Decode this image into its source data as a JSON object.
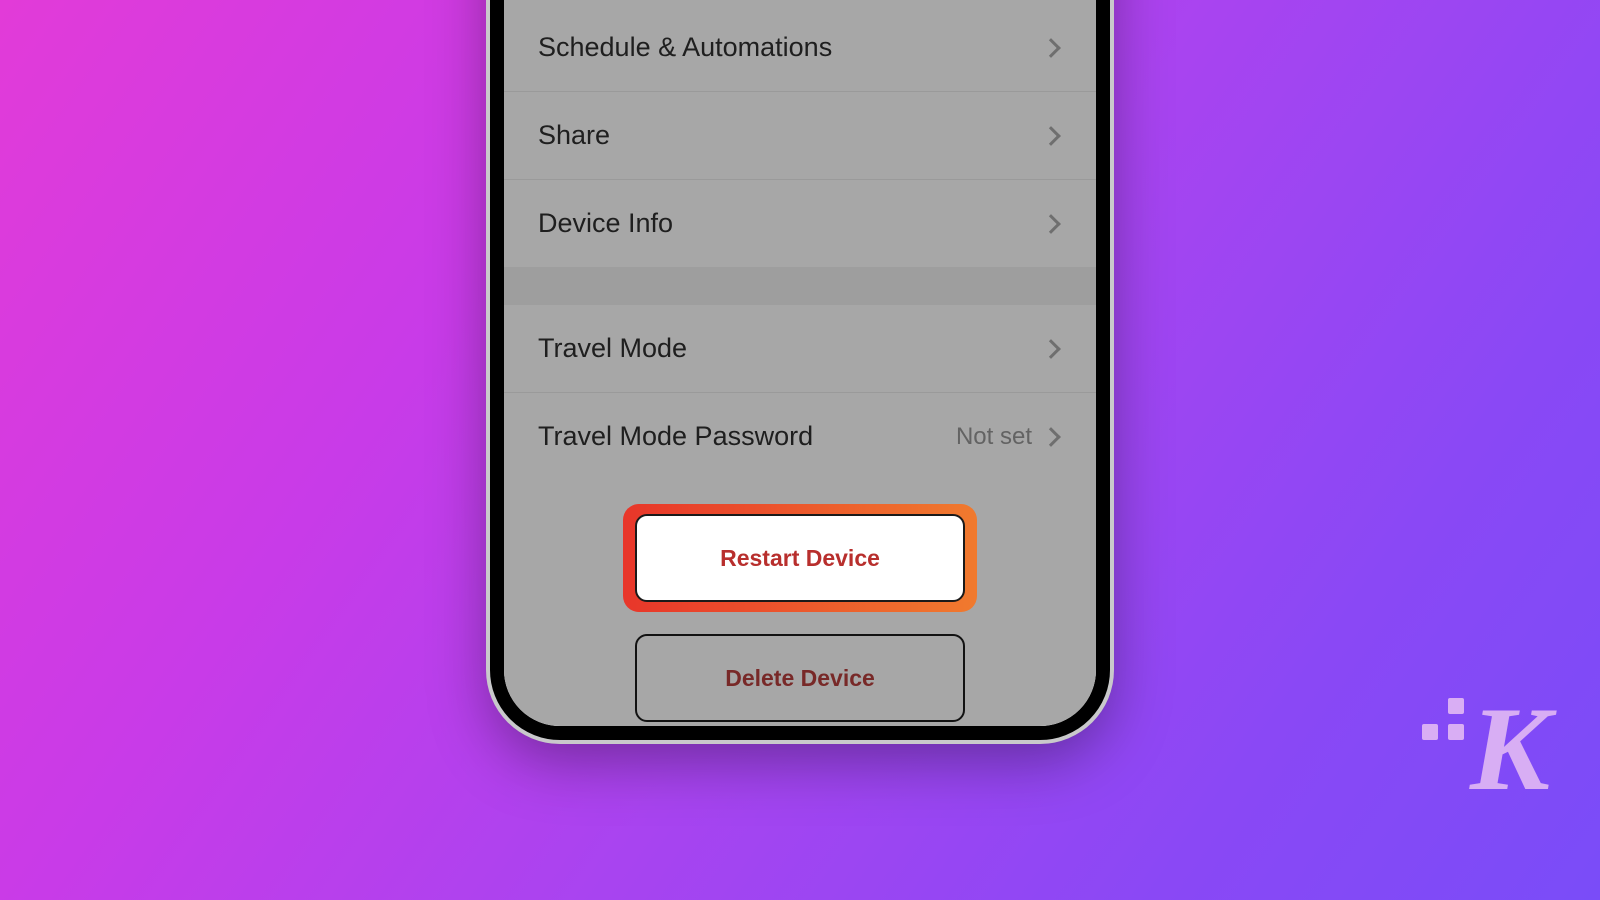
{
  "settings": {
    "rows": [
      {
        "label": "Schedule & Automations"
      },
      {
        "label": "Share"
      },
      {
        "label": "Device Info"
      }
    ],
    "travel": {
      "mode_label": "Travel Mode",
      "password_label": "Travel Mode Password",
      "password_value": "Not set"
    }
  },
  "buttons": {
    "restart": "Restart Device",
    "delete": "Delete Device"
  },
  "watermark": {
    "letter": "K"
  }
}
